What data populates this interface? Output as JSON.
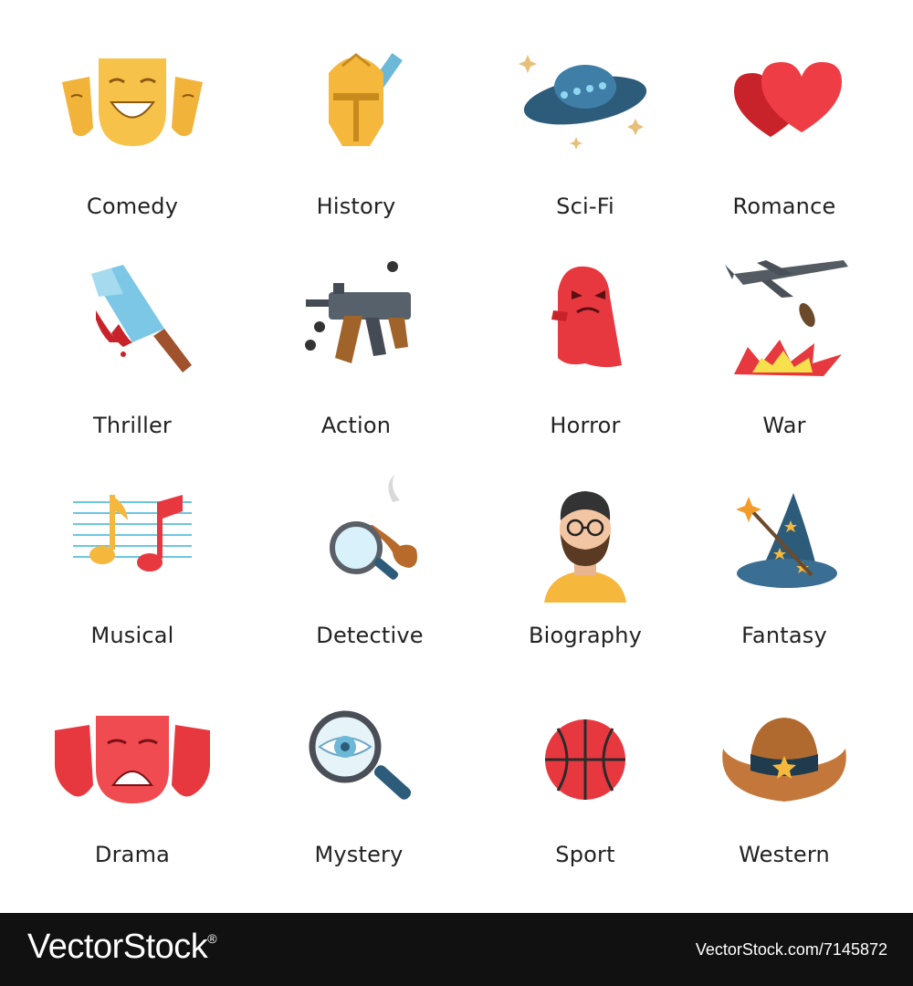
{
  "genres": [
    {
      "label": "Comedy",
      "icon": "comedy-mask-icon"
    },
    {
      "label": "History",
      "icon": "knight-helmet-icon"
    },
    {
      "label": "Sci-Fi",
      "icon": "ufo-icon"
    },
    {
      "label": "Romance",
      "icon": "hearts-icon"
    },
    {
      "label": "Thriller",
      "icon": "cleaver-icon"
    },
    {
      "label": "Action",
      "icon": "gun-icon"
    },
    {
      "label": "Horror",
      "icon": "ghost-icon"
    },
    {
      "label": "War",
      "icon": "bomber-plane-icon"
    },
    {
      "label": "Musical",
      "icon": "music-notes-icon"
    },
    {
      "label": "Detective",
      "icon": "magnifier-pipe-icon"
    },
    {
      "label": "Biography",
      "icon": "person-portrait-icon"
    },
    {
      "label": "Fantasy",
      "icon": "wizard-hat-icon"
    },
    {
      "label": "Drama",
      "icon": "drama-mask-icon"
    },
    {
      "label": "Mystery",
      "icon": "magnifier-eye-icon"
    },
    {
      "label": "Sport",
      "icon": "basketball-icon"
    },
    {
      "label": "Western",
      "icon": "cowboy-hat-icon"
    }
  ],
  "footer": {
    "brand": "VectorStock",
    "registered": "®",
    "credit": "VectorStock.com/7145872"
  },
  "colors": {
    "yellow": "#f5b83d",
    "red": "#e8383f",
    "blue": "#2d5b7a",
    "footer_bg": "#111111"
  }
}
